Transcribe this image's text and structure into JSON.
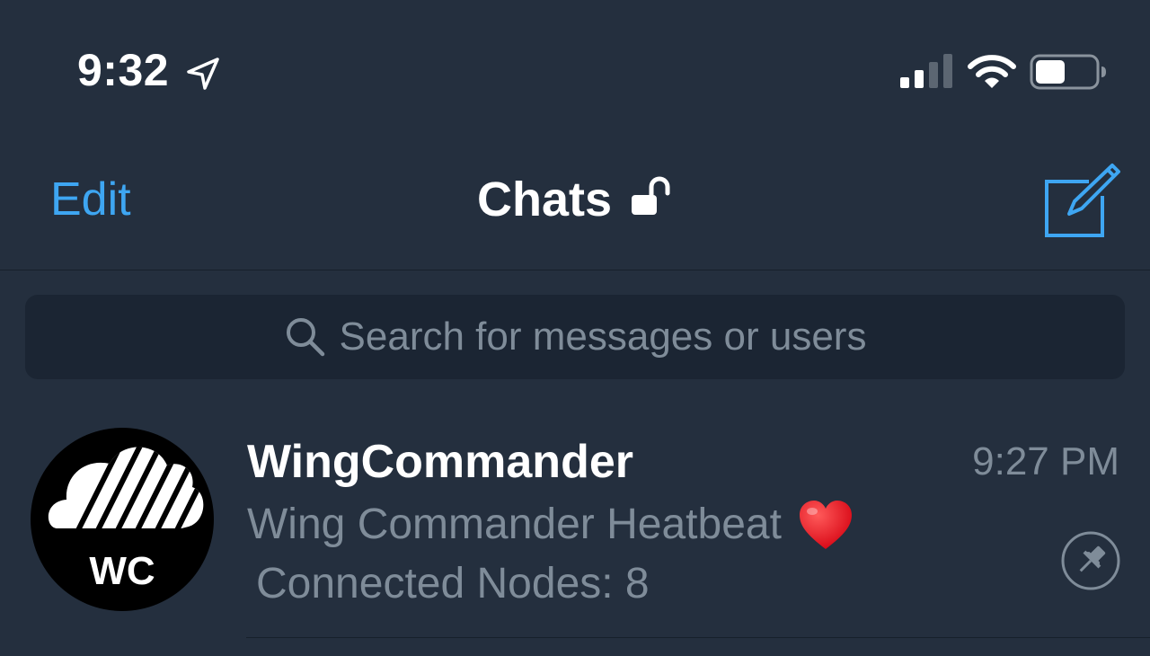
{
  "status_bar": {
    "time": "9:32",
    "location_icon": "location-arrow-icon",
    "signal_icon": "cellular-signal-icon",
    "wifi_icon": "wifi-icon",
    "battery_icon": "battery-icon"
  },
  "nav": {
    "edit_label": "Edit",
    "title": "Chats",
    "lock_icon": "unlocked-padlock-icon",
    "compose_icon": "compose-icon"
  },
  "search": {
    "placeholder": "Search for messages or users",
    "icon": "search-icon"
  },
  "chats": [
    {
      "name": "WingCommander",
      "time": "9:27 PM",
      "preview_line1": "Wing Commander Heatbeat",
      "preview_emoji": "heart-icon",
      "preview_line2": "Connected Nodes: 8",
      "avatar_text": "WC",
      "pinned": true
    }
  ],
  "colors": {
    "background": "#242f3e",
    "accent": "#3ea6f2",
    "secondary_text": "#7f8c99",
    "search_bg": "#1b2533"
  }
}
